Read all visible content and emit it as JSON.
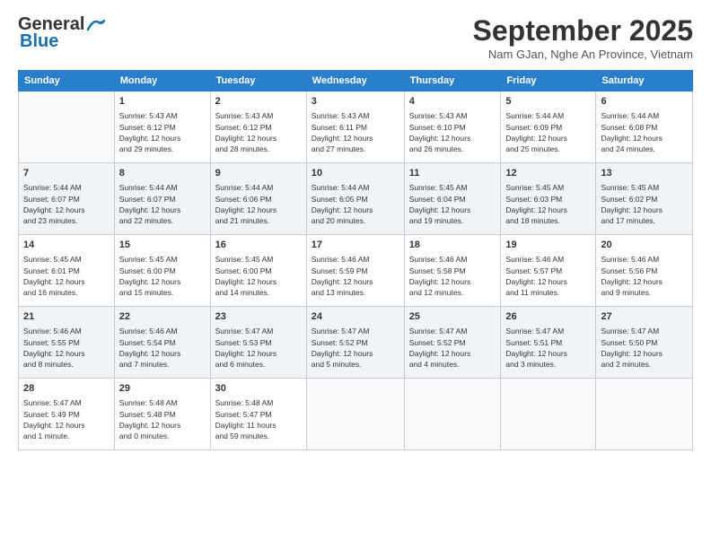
{
  "header": {
    "logo_line1": "General",
    "logo_line2": "Blue",
    "month": "September 2025",
    "location": "Nam GJan, Nghe An Province, Vietnam"
  },
  "weekdays": [
    "Sunday",
    "Monday",
    "Tuesday",
    "Wednesday",
    "Thursday",
    "Friday",
    "Saturday"
  ],
  "weeks": [
    [
      {
        "day": "",
        "info": ""
      },
      {
        "day": "1",
        "info": "Sunrise: 5:43 AM\nSunset: 6:12 PM\nDaylight: 12 hours\nand 29 minutes."
      },
      {
        "day": "2",
        "info": "Sunrise: 5:43 AM\nSunset: 6:12 PM\nDaylight: 12 hours\nand 28 minutes."
      },
      {
        "day": "3",
        "info": "Sunrise: 5:43 AM\nSunset: 6:11 PM\nDaylight: 12 hours\nand 27 minutes."
      },
      {
        "day": "4",
        "info": "Sunrise: 5:43 AM\nSunset: 6:10 PM\nDaylight: 12 hours\nand 26 minutes."
      },
      {
        "day": "5",
        "info": "Sunrise: 5:44 AM\nSunset: 6:09 PM\nDaylight: 12 hours\nand 25 minutes."
      },
      {
        "day": "6",
        "info": "Sunrise: 5:44 AM\nSunset: 6:08 PM\nDaylight: 12 hours\nand 24 minutes."
      }
    ],
    [
      {
        "day": "7",
        "info": "Sunrise: 5:44 AM\nSunset: 6:07 PM\nDaylight: 12 hours\nand 23 minutes."
      },
      {
        "day": "8",
        "info": "Sunrise: 5:44 AM\nSunset: 6:07 PM\nDaylight: 12 hours\nand 22 minutes."
      },
      {
        "day": "9",
        "info": "Sunrise: 5:44 AM\nSunset: 6:06 PM\nDaylight: 12 hours\nand 21 minutes."
      },
      {
        "day": "10",
        "info": "Sunrise: 5:44 AM\nSunset: 6:05 PM\nDaylight: 12 hours\nand 20 minutes."
      },
      {
        "day": "11",
        "info": "Sunrise: 5:45 AM\nSunset: 6:04 PM\nDaylight: 12 hours\nand 19 minutes."
      },
      {
        "day": "12",
        "info": "Sunrise: 5:45 AM\nSunset: 6:03 PM\nDaylight: 12 hours\nand 18 minutes."
      },
      {
        "day": "13",
        "info": "Sunrise: 5:45 AM\nSunset: 6:02 PM\nDaylight: 12 hours\nand 17 minutes."
      }
    ],
    [
      {
        "day": "14",
        "info": "Sunrise: 5:45 AM\nSunset: 6:01 PM\nDaylight: 12 hours\nand 16 minutes."
      },
      {
        "day": "15",
        "info": "Sunrise: 5:45 AM\nSunset: 6:00 PM\nDaylight: 12 hours\nand 15 minutes."
      },
      {
        "day": "16",
        "info": "Sunrise: 5:45 AM\nSunset: 6:00 PM\nDaylight: 12 hours\nand 14 minutes."
      },
      {
        "day": "17",
        "info": "Sunrise: 5:46 AM\nSunset: 5:59 PM\nDaylight: 12 hours\nand 13 minutes."
      },
      {
        "day": "18",
        "info": "Sunrise: 5:46 AM\nSunset: 5:58 PM\nDaylight: 12 hours\nand 12 minutes."
      },
      {
        "day": "19",
        "info": "Sunrise: 5:46 AM\nSunset: 5:57 PM\nDaylight: 12 hours\nand 11 minutes."
      },
      {
        "day": "20",
        "info": "Sunrise: 5:46 AM\nSunset: 5:56 PM\nDaylight: 12 hours\nand 9 minutes."
      }
    ],
    [
      {
        "day": "21",
        "info": "Sunrise: 5:46 AM\nSunset: 5:55 PM\nDaylight: 12 hours\nand 8 minutes."
      },
      {
        "day": "22",
        "info": "Sunrise: 5:46 AM\nSunset: 5:54 PM\nDaylight: 12 hours\nand 7 minutes."
      },
      {
        "day": "23",
        "info": "Sunrise: 5:47 AM\nSunset: 5:53 PM\nDaylight: 12 hours\nand 6 minutes."
      },
      {
        "day": "24",
        "info": "Sunrise: 5:47 AM\nSunset: 5:52 PM\nDaylight: 12 hours\nand 5 minutes."
      },
      {
        "day": "25",
        "info": "Sunrise: 5:47 AM\nSunset: 5:52 PM\nDaylight: 12 hours\nand 4 minutes."
      },
      {
        "day": "26",
        "info": "Sunrise: 5:47 AM\nSunset: 5:51 PM\nDaylight: 12 hours\nand 3 minutes."
      },
      {
        "day": "27",
        "info": "Sunrise: 5:47 AM\nSunset: 5:50 PM\nDaylight: 12 hours\nand 2 minutes."
      }
    ],
    [
      {
        "day": "28",
        "info": "Sunrise: 5:47 AM\nSunset: 5:49 PM\nDaylight: 12 hours\nand 1 minute."
      },
      {
        "day": "29",
        "info": "Sunrise: 5:48 AM\nSunset: 5:48 PM\nDaylight: 12 hours\nand 0 minutes."
      },
      {
        "day": "30",
        "info": "Sunrise: 5:48 AM\nSunset: 5:47 PM\nDaylight: 11 hours\nand 59 minutes."
      },
      {
        "day": "",
        "info": ""
      },
      {
        "day": "",
        "info": ""
      },
      {
        "day": "",
        "info": ""
      },
      {
        "day": "",
        "info": ""
      }
    ]
  ]
}
